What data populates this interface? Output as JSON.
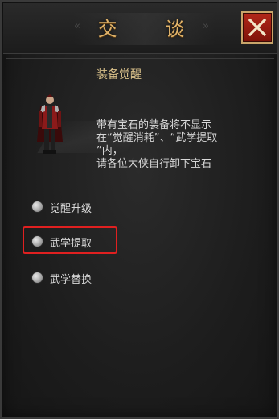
{
  "dialog": {
    "title": "交 谈",
    "title_deco_left": "«",
    "title_deco_right": "»",
    "close_icon": "close-x-icon"
  },
  "content": {
    "section_title": "装备觉醒",
    "npc_icon": "armored-warrior-figure",
    "info_lines": [
      "带有宝石的装备将不显示",
      "在“觉醒消耗”、“武学提取",
      "”内，",
      "请各位大侠自行卸下宝石"
    ]
  },
  "options": [
    {
      "label": "觉醒升级",
      "highlighted": false
    },
    {
      "label": "武学提取",
      "highlighted": true
    },
    {
      "label": "武学替换",
      "highlighted": false
    }
  ],
  "colors": {
    "title_gold": "#e0b36a",
    "section_title": "#d9c08a",
    "close_red": "#b3281a",
    "highlight_red": "#e02020",
    "text": "#d8d8d8"
  }
}
